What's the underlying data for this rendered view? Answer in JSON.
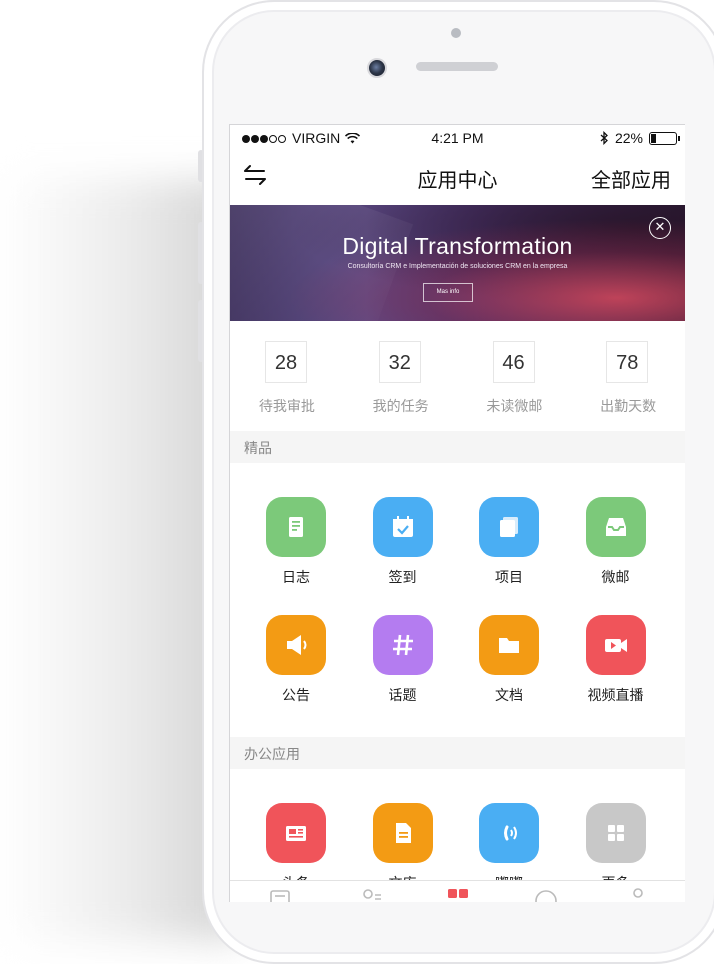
{
  "status": {
    "carrier": "VIRGIN",
    "time": "4:21 PM",
    "battery": "22%",
    "battery_level": 0.22
  },
  "nav": {
    "back_icon": "swap-arrows-icon",
    "title": "应用中心",
    "right": "全部应用"
  },
  "banner": {
    "title": "Digital Transformation",
    "subtitle": "Consultoría CRM e Implementación de soluciones CRM en la empresa",
    "button": "Mas info",
    "close_icon": "close-icon"
  },
  "stats": [
    {
      "value": "28",
      "label": "待我审批"
    },
    {
      "value": "32",
      "label": "我的任务"
    },
    {
      "value": "46",
      "label": "未读微邮"
    },
    {
      "value": "78",
      "label": "出勤天数"
    }
  ],
  "sections": [
    {
      "title": "精品"
    },
    {
      "title": "办公应用"
    }
  ],
  "featured_apps": [
    {
      "name": "日志",
      "icon": "document-icon",
      "color": "#7CC97A"
    },
    {
      "name": "签到",
      "icon": "calendar-check-icon",
      "color": "#4AAEF3"
    },
    {
      "name": "项目",
      "icon": "stack-icon",
      "color": "#4AAEF3"
    },
    {
      "name": "微邮",
      "icon": "inbox-icon",
      "color": "#7CC97A"
    },
    {
      "name": "公告",
      "icon": "megaphone-icon",
      "color": "#F39B14"
    },
    {
      "name": "话题",
      "icon": "hashtag-icon",
      "color": "#B47CF0"
    },
    {
      "name": "文档",
      "icon": "folder-icon",
      "color": "#F39B14"
    },
    {
      "name": "视频直播",
      "icon": "video-icon",
      "color": "#F0545A"
    }
  ],
  "office_apps": [
    {
      "name": "头条",
      "icon": "news-icon",
      "color": "#F0545A"
    },
    {
      "name": "文库",
      "icon": "file-icon",
      "color": "#F39B14"
    },
    {
      "name": "嘟嘟",
      "icon": "phone-call-icon",
      "color": "#4AAEF3"
    },
    {
      "name": "更多",
      "icon": "grid-icon",
      "color": "#C8C8C8"
    }
  ],
  "tabbar": [
    {
      "icon": "message-icon",
      "color": "#bbbbbb"
    },
    {
      "icon": "contacts-icon",
      "color": "#bbbbbb"
    },
    {
      "icon": "apps-icon",
      "color": "#F0545A"
    },
    {
      "icon": "discover-icon",
      "color": "#bbbbbb"
    },
    {
      "icon": "profile-icon",
      "color": "#bbbbbb"
    }
  ]
}
